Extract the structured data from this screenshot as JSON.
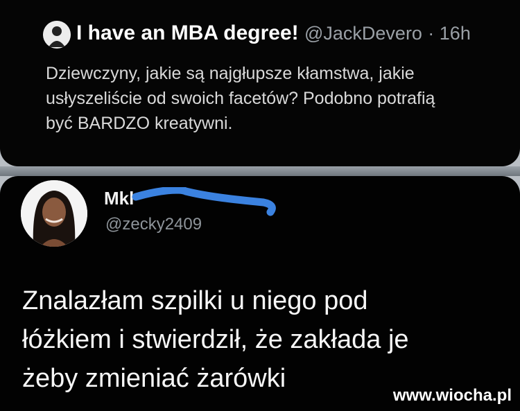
{
  "tweet1": {
    "display_name": "I have an MBA degree!",
    "handle": "@JackDevero",
    "time": "· 16h",
    "lines": [
      "Dziewczyny, jakie są najgłupsze kłamstwa, jakie",
      "usłyszeliście od swoich facetów? Podobno potrafią",
      "być BARDZO kreatywni."
    ]
  },
  "tweet2": {
    "display_name_visible": "Mkl",
    "handle": "@zecky2409",
    "lines": [
      "Znalazłam szpilki u niego pod",
      "łóżkiem i stwierdził, że zakłada je",
      "żeby zmieniać żarówki"
    ]
  },
  "watermark": "www.wiocha.pl",
  "colors": {
    "background": "#050505",
    "redaction": "#3b82e0"
  },
  "icons": {
    "avatar_small": "avatar-icon",
    "avatar_big": "avatar-photo"
  }
}
